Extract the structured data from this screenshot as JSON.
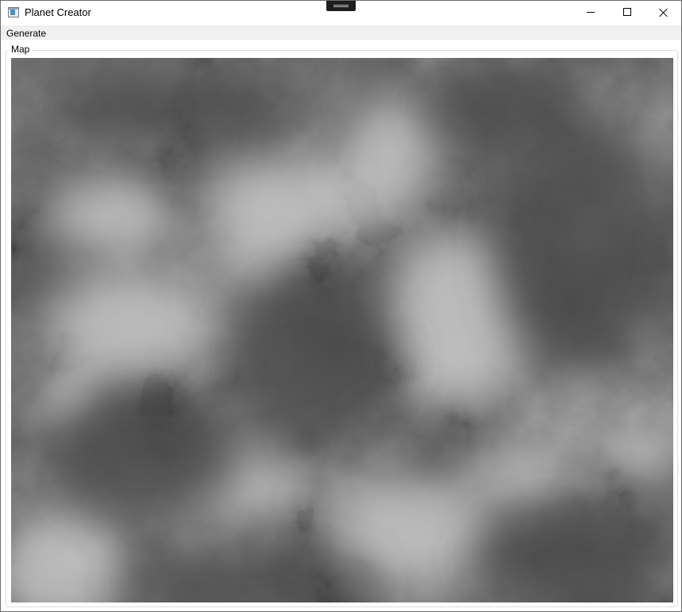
{
  "window": {
    "title": "Planet Creator",
    "icon": "app-window-icon",
    "controls": {
      "minimize": "minimize-icon",
      "maximize": "maximize-icon",
      "close": "close-icon"
    }
  },
  "menu": {
    "items": [
      {
        "label": "Generate"
      }
    ]
  },
  "map_group": {
    "label": "Map",
    "image": "grayscale-heightmap",
    "colors": {
      "low": "#535353",
      "high": "#d6d6d6"
    }
  }
}
